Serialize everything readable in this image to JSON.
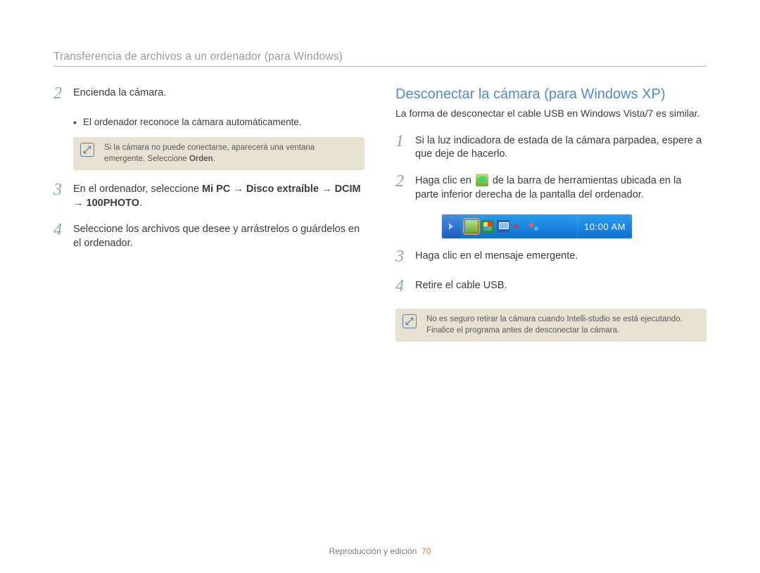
{
  "header": {
    "title": "Transferencia de archivos a un ordenador (para Windows)"
  },
  "left": {
    "steps": {
      "2": {
        "num": "2",
        "text": "Encienda la cámara."
      },
      "3": {
        "num": "3",
        "pre": "En el ordenador, seleccione ",
        "b1": "Mi PC",
        "arr1": " → ",
        "b2": "Disco extraíble",
        "arr2": " → ",
        "b3": "DCIM",
        "arr3": " → ",
        "b4": "100PHOTO",
        "post": "."
      },
      "4": {
        "num": "4",
        "text": "Seleccione los archivos que desee y arrástrelos o guárdelos en el ordenador."
      }
    },
    "bullet": "El ordenador reconoce la cámara automáticamente.",
    "note": {
      "line": "Si la cámara no puede conectarse, aparecerá una ventana emergente. Seleccione ",
      "bold": "Orden",
      "post": "."
    }
  },
  "right": {
    "heading": "Desconectar la cámara (para Windows XP)",
    "sub": "La forma de desconectar el cable USB en Windows Vista/7 es similar.",
    "steps": {
      "1": {
        "num": "1",
        "text": "Si la luz indicadora de estada de la cámara parpadea, espere a que deje de hacerlo."
      },
      "2": {
        "num": "2",
        "pre": "Haga clic en ",
        "post": " de la barra de herramientas ubicada en la parte inferior derecha de la pantalla del ordenador."
      },
      "3": {
        "num": "3",
        "text": "Haga clic en el mensaje emergente."
      },
      "4": {
        "num": "4",
        "text": "Retire el cable USB."
      }
    },
    "taskbar": {
      "time": "10:00 AM"
    },
    "note": {
      "text": "No es seguro retirar la cámara cuando Intelli-studio se está ejecutando. Finalice el programa antes de desconectar la cámara."
    }
  },
  "footer": {
    "section": "Reproducción y edición",
    "page": "70"
  }
}
